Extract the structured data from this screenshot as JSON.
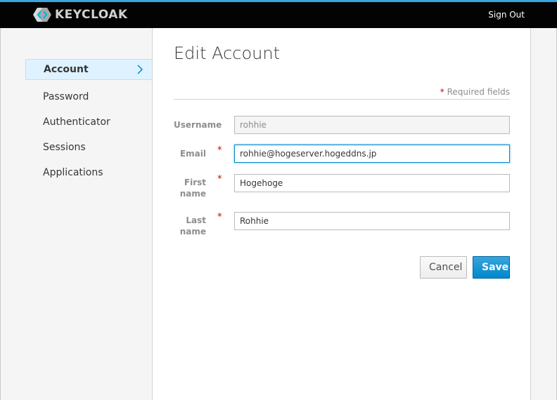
{
  "header": {
    "brand": "KEYCLOAK",
    "signout_label": "Sign Out"
  },
  "sidebar": {
    "items": [
      {
        "label": "Account",
        "active": true
      },
      {
        "label": "Password"
      },
      {
        "label": "Authenticator"
      },
      {
        "label": "Sessions"
      },
      {
        "label": "Applications"
      }
    ]
  },
  "main": {
    "title": "Edit Account",
    "required_star": "*",
    "required_text": "Required fields",
    "fields": {
      "username": {
        "label": "Username",
        "value": "rohhie"
      },
      "email": {
        "label": "Email",
        "value": "rohhie@hogeserver.hogeddns.jp"
      },
      "first_name": {
        "label_line1": "First",
        "label_line2": "name",
        "value": "Hogehoge"
      },
      "last_name": {
        "label_line1": "Last",
        "label_line2": "name",
        "value": "Rohhie"
      }
    },
    "buttons": {
      "cancel": "Cancel",
      "save": "Save"
    }
  },
  "colors": {
    "accent": "#0088ce",
    "topbar": "#030303",
    "required": "#cc0000"
  }
}
